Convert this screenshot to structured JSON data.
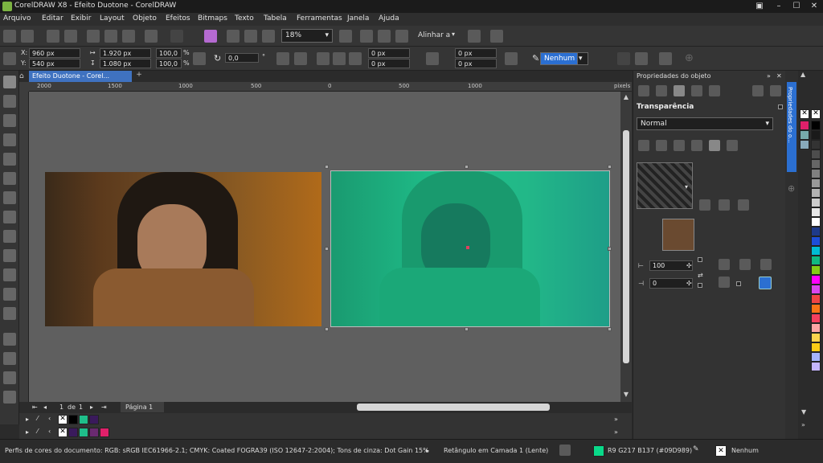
{
  "window": {
    "title": "CorelDRAW X8 - Efeito Duotone - CorelDRAW"
  },
  "menu": [
    "Arquivo",
    "Editar",
    "Exibir",
    "Layout",
    "Objeto",
    "Efeitos",
    "Bitmaps",
    "Texto",
    "Tabela",
    "Ferramentas",
    "Janela",
    "Ajuda"
  ],
  "toolbar1": {
    "zoom": "18%",
    "align_label": "Alinhar a"
  },
  "toolbar2": {
    "x": "960 px",
    "y": "540 px",
    "w": "1.920 px",
    "h": "1.080 px",
    "scale_w": "100,0",
    "scale_h": "100,0",
    "pct": "%",
    "angle": "0,0",
    "corner1": "0 px",
    "corner2": "0 px",
    "corner3": "0 px",
    "corner4": "0 px",
    "outline": "Nenhum"
  },
  "doc_tab": "Efeito Duotone - Corel...",
  "ruler_ticks": [
    "2000",
    "1500",
    "1000",
    "500",
    "0",
    "500",
    "1000",
    "pixels"
  ],
  "page_nav": {
    "page": "1",
    "of": "de",
    "total": "1",
    "page_tab": "Página 1"
  },
  "props": {
    "title": "Propriedades do objeto",
    "section": "Transparência",
    "blend_mode": "Normal",
    "value1": "100",
    "value2": "0"
  },
  "docker_tab": "Propriedades do o...",
  "status": {
    "color_profile": "Perfis de cores do documento: RGB: sRGB IEC61966-2.1; CMYK: Coated FOGRA39 (ISO 12647-2:2004); Tons de cinza: Dot Gain 15%",
    "object": "Retângulo em Camada 1  (Lente)",
    "fill": "R9 G217 B137 (#09D989)",
    "outline": "Nenhum"
  },
  "colors": {
    "teal": "#1fbf8a",
    "palette": [
      "#000000",
      "#1fbf8a",
      "#3a1a5c",
      "#e0206a"
    ]
  }
}
